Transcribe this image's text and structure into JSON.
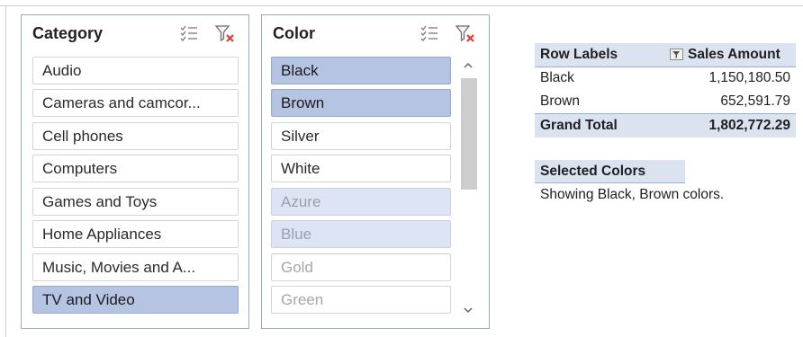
{
  "slicers": {
    "category": {
      "title": "Category",
      "items": [
        {
          "label": "Audio",
          "state": "normal"
        },
        {
          "label": "Cameras and camcor...",
          "state": "normal"
        },
        {
          "label": "Cell phones",
          "state": "normal"
        },
        {
          "label": "Computers",
          "state": "normal"
        },
        {
          "label": "Games and Toys",
          "state": "normal"
        },
        {
          "label": "Home Appliances",
          "state": "normal"
        },
        {
          "label": "Music, Movies and A...",
          "state": "normal"
        },
        {
          "label": "TV and Video",
          "state": "selected"
        }
      ],
      "icons": {
        "multiselect": "multi-select-icon",
        "clear": "clear-filter-icon"
      }
    },
    "color": {
      "title": "Color",
      "items": [
        {
          "label": "Black",
          "state": "selected"
        },
        {
          "label": "Brown",
          "state": "selected"
        },
        {
          "label": "Silver",
          "state": "normal"
        },
        {
          "label": "White",
          "state": "normal"
        },
        {
          "label": "Azure",
          "state": "nodata-selected"
        },
        {
          "label": "Blue",
          "state": "nodata-selected"
        },
        {
          "label": "Gold",
          "state": "nodata"
        },
        {
          "label": "Green",
          "state": "nodata"
        }
      ],
      "icons": {
        "multiselect": "multi-select-icon",
        "clear": "clear-filter-icon",
        "scroll_up": "chevron-up-icon",
        "scroll_down": "chevron-down-icon"
      }
    }
  },
  "pivot": {
    "headers": {
      "row_labels": "Row Labels",
      "sales_amount": "Sales Amount"
    },
    "rows": [
      {
        "label": "Black",
        "value": "1,150,180.50"
      },
      {
        "label": "Brown",
        "value": "652,591.79"
      }
    ],
    "total": {
      "label": "Grand Total",
      "value": "1,802,772.29"
    }
  },
  "selected_colors": {
    "title": "Selected Colors",
    "text": "Showing Black, Brown colors."
  },
  "colors": {
    "selected_fill": "#b6c4e4",
    "nodata_selected_fill": "#dde4f3",
    "header_fill": "#dce3f0",
    "clear_filter_red": "#e03c31"
  }
}
